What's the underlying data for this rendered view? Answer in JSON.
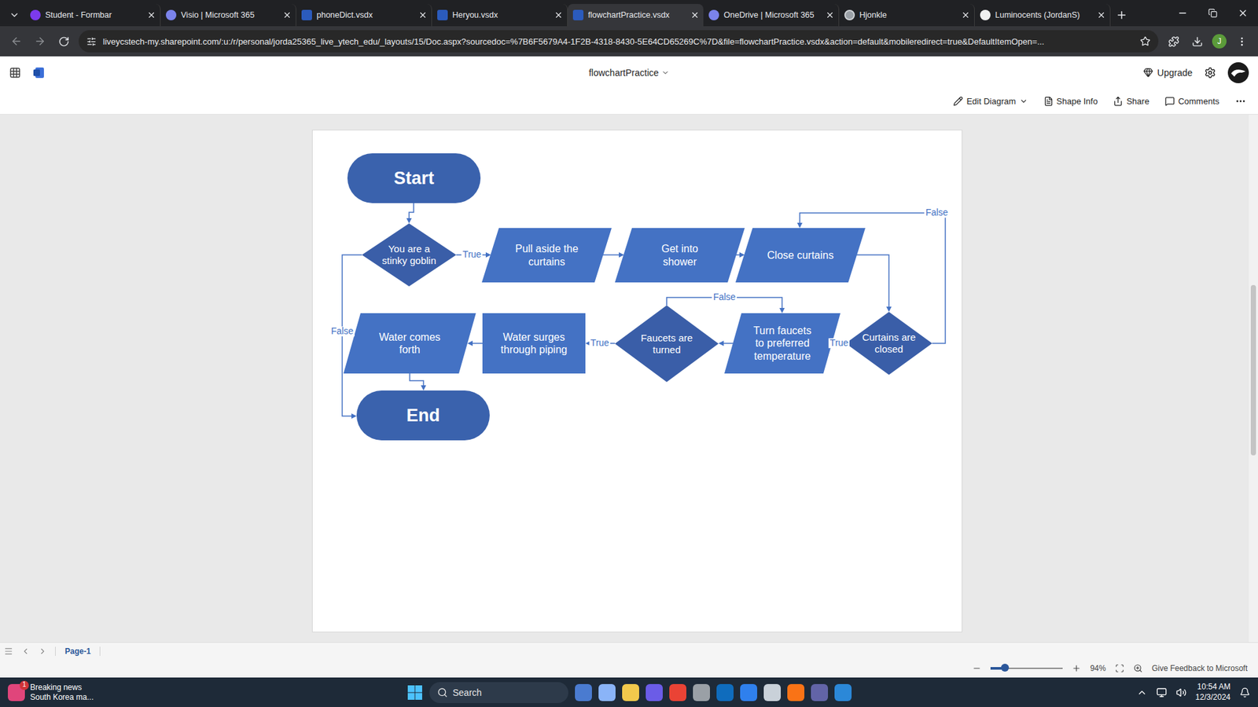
{
  "browser": {
    "tabs": [
      {
        "label": "Student - Formbar",
        "selected": false,
        "kind": "formbar"
      },
      {
        "label": "Visio | Microsoft 365",
        "selected": false,
        "kind": "visio"
      },
      {
        "label": "phoneDict.vsdx",
        "selected": false,
        "kind": "vsdx"
      },
      {
        "label": "Heryou.vsdx",
        "selected": false,
        "kind": "vsdx"
      },
      {
        "label": "flowchartPractice.vsdx",
        "selected": true,
        "kind": "vsdx"
      },
      {
        "label": "OneDrive | Microsoft 365",
        "selected": false,
        "kind": "visio"
      },
      {
        "label": "Hjonkle",
        "selected": false,
        "kind": "web"
      },
      {
        "label": "Luminocents (JordanS)",
        "selected": false,
        "kind": "github"
      }
    ],
    "url": "liveycstech-my.sharepoint.com/:u:/r/personal/jorda25365_live_ytech_edu/_layouts/15/Doc.aspx?sourcedoc=%7B6F5679A4-1F2B-4318-8430-5E64CD65269C%7D&file=flowchartPractice.vsdx&action=default&mobileredirect=true&DefaultItemOpen=...",
    "profile": "J"
  },
  "app": {
    "title": "flowchartPractice",
    "upgrade": "Upgrade"
  },
  "toolbar": [
    "Edit Diagram",
    "Shape Info",
    "Share",
    "Comments"
  ],
  "diagram": {
    "nodes": [
      {
        "text": "Start",
        "kind": "terminator"
      },
      {
        "text": "You are a stinky goblin",
        "kind": "decision"
      },
      {
        "text": "Pull aside the curtains",
        "kind": "io"
      },
      {
        "text": "Get into shower",
        "kind": "io"
      },
      {
        "text": "Close curtains",
        "kind": "io"
      },
      {
        "text": "Curtains are closed",
        "kind": "decision"
      },
      {
        "text": "Turn faucets to preferred temperature",
        "kind": "io"
      },
      {
        "text": "Faucets are turned",
        "kind": "decision"
      },
      {
        "text": "Water surges through piping",
        "kind": "process"
      },
      {
        "text": "Water comes forth",
        "kind": "io"
      },
      {
        "text": "End",
        "kind": "terminator"
      }
    ],
    "edge_labels": [
      "True",
      "False",
      "True",
      "False",
      "True",
      "False"
    ]
  },
  "pages": [
    {
      "label": "Page-1",
      "selected": true
    }
  ],
  "status_bar": {
    "zoom": "94%",
    "zoom_level": 0.2,
    "feedback": "Give Feedback to Microsoft"
  },
  "taskbar": {
    "news_badge": "1",
    "news_title": "Breaking news",
    "news_text": "South Korea ma...",
    "search": "Search",
    "time": "10:54 AM",
    "date": "12/3/2024"
  }
}
